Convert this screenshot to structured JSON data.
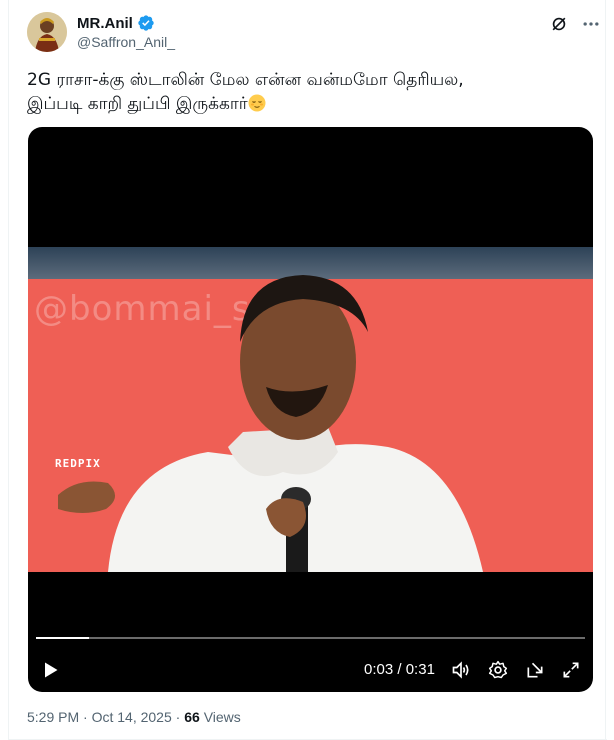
{
  "author": {
    "display_name": "MR.Anil",
    "handle": "@Saffron_Anil_",
    "verified": true,
    "verified_color": "#1d9bf0"
  },
  "tweet": {
    "text_line1": "2G ராசா-க்கு ஸ்டாலின் மேல என்ன வன்மமோ தெரியல,",
    "text_line2": "இப்படி காறி துப்பி இருக்கார்",
    "emoji": "relieved-face"
  },
  "video": {
    "watermark": "@bommai_stalin",
    "logo": "REDPIX",
    "current_time": "0:03",
    "separator": "/",
    "duration": "0:31",
    "progress": 0.097
  },
  "meta": {
    "time": "5:29 PM",
    "dot1": "·",
    "date": "Oct 14, 2025",
    "dot2": "·",
    "views_count": "66",
    "views_label": "Views"
  },
  "icons": {
    "grok": "grok-icon",
    "more": "more-icon",
    "play": "play-icon",
    "volume": "volume-icon",
    "settings": "settings-icon",
    "pip": "pip-icon",
    "fullscreen": "fullscreen-icon"
  }
}
